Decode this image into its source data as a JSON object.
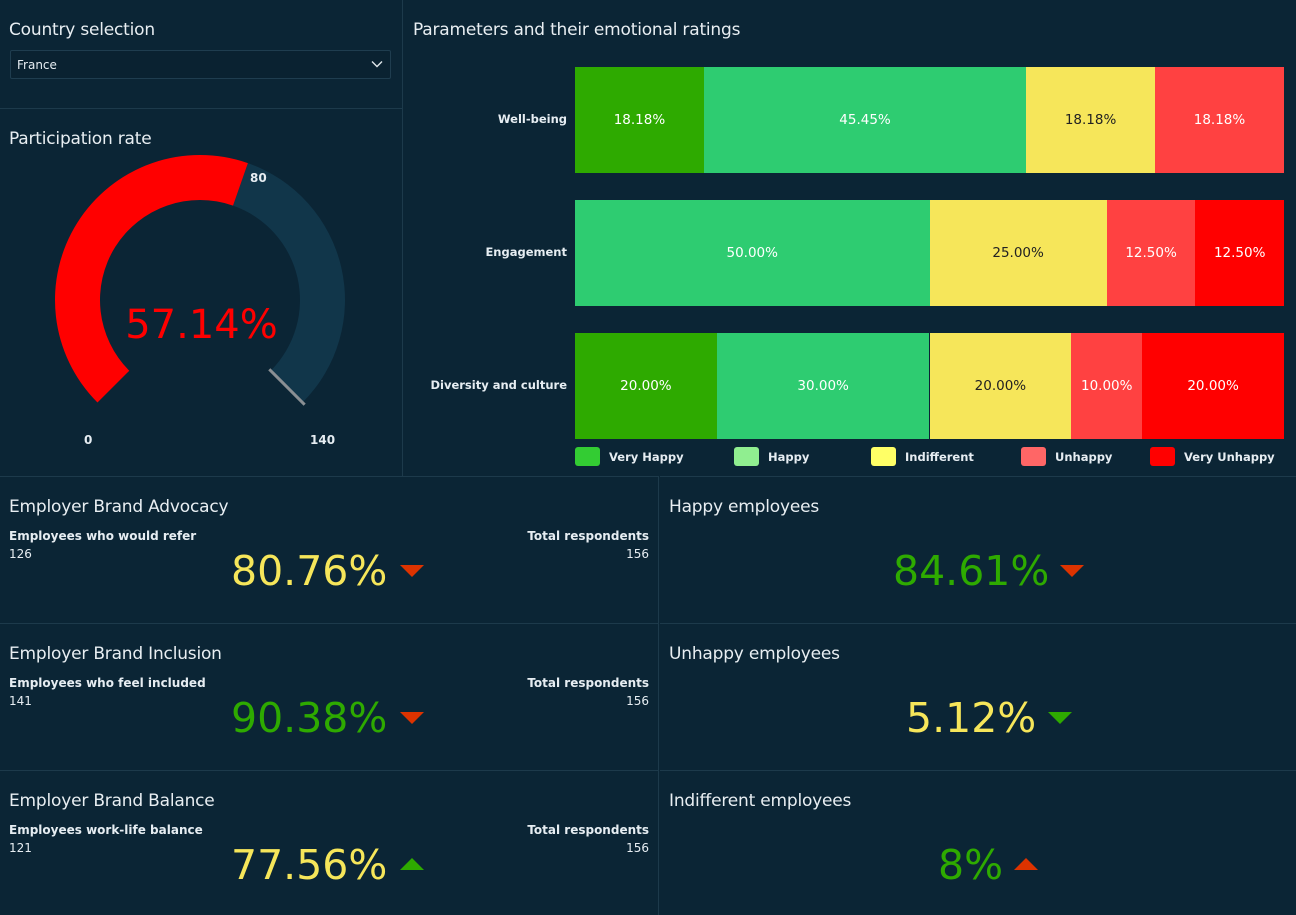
{
  "country_selection": {
    "title": "Country selection",
    "selected": "France"
  },
  "participation": {
    "title": "Participation rate",
    "value_label": "57.14%",
    "value": 80,
    "min": 0,
    "max": 140,
    "min_label": "0",
    "target_label": "80",
    "max_label": "140",
    "fill_color": "#ff0000",
    "track_color": "#11364a"
  },
  "params_chart": {
    "title": "Parameters and their emotional ratings"
  },
  "chart_data": {
    "type": "bar",
    "orientation": "horizontal",
    "stacked": "percent",
    "title": "Parameters and their emotional ratings",
    "categories": [
      "Well-being",
      "Engagement",
      "Diversity and culture"
    ],
    "series": [
      {
        "name": "Very Happy",
        "color": "#2eaa00",
        "legend_color": "#33cc33",
        "text_color": "#ffffff",
        "values": [
          18.18,
          0,
          20.0
        ],
        "labels": [
          "18.18%",
          "",
          "20.00%"
        ]
      },
      {
        "name": "Happy",
        "color": "#2ecc71",
        "legend_color": "#90ee90",
        "text_color": "#ffffff",
        "values": [
          45.45,
          50.0,
          30.0
        ],
        "labels": [
          "45.45%",
          "50.00%",
          "30.00%"
        ]
      },
      {
        "name": "Indifferent",
        "color": "#f6e65a",
        "legend_color": "#ffff66",
        "text_color": "#222222",
        "values": [
          18.18,
          25.0,
          20.0
        ],
        "labels": [
          "18.18%",
          "25.00%",
          "20.00%"
        ]
      },
      {
        "name": "Unhappy",
        "color": "#ff4141",
        "legend_color": "#ff6666",
        "text_color": "#ffffff",
        "values": [
          18.18,
          12.5,
          10.0
        ],
        "labels": [
          "18.18%",
          "12.50%",
          "10.00%"
        ]
      },
      {
        "name": "Very Unhappy",
        "color": "#ff0000",
        "legend_color": "#ff0000",
        "text_color": "#ffffff",
        "values": [
          0,
          12.5,
          20.0
        ],
        "labels": [
          "",
          "12.50%",
          "20.00%"
        ]
      }
    ],
    "xlim": [
      0,
      100
    ],
    "legend_position": "bottom"
  },
  "kpis_left": [
    {
      "title": "Employer Brand Advocacy",
      "left_label": "Employees who would refer",
      "left_value": "126",
      "right_label": "Total respondents",
      "right_value": "156",
      "value": "80.76%",
      "value_color": "#f6e65a",
      "trend": "down",
      "trend_color": "#dd3300"
    },
    {
      "title": "Employer Brand Inclusion",
      "left_label": "Employees who feel included",
      "left_value": "141",
      "right_label": "Total respondents",
      "right_value": "156",
      "value": "90.38%",
      "value_color": "#2eaa00",
      "trend": "down",
      "trend_color": "#dd3300"
    },
    {
      "title": "Employer Brand Balance",
      "left_label": "Employees work-life balance",
      "left_value": "121",
      "right_label": "Total respondents",
      "right_value": "156",
      "value": "77.56%",
      "value_color": "#f6e65a",
      "trend": "up",
      "trend_color": "#2eaa00"
    }
  ],
  "kpis_right": [
    {
      "title": "Happy employees",
      "value": "84.61%",
      "value_color": "#2eaa00",
      "trend": "down",
      "trend_color": "#dd3300"
    },
    {
      "title": "Unhappy employees",
      "value": "5.12%",
      "value_color": "#f6e65a",
      "trend": "down",
      "trend_color": "#2eaa00"
    },
    {
      "title": "Indifferent employees",
      "value": "8%",
      "value_color": "#2eaa00",
      "trend": "up",
      "trend_color": "#dd3300"
    }
  ]
}
